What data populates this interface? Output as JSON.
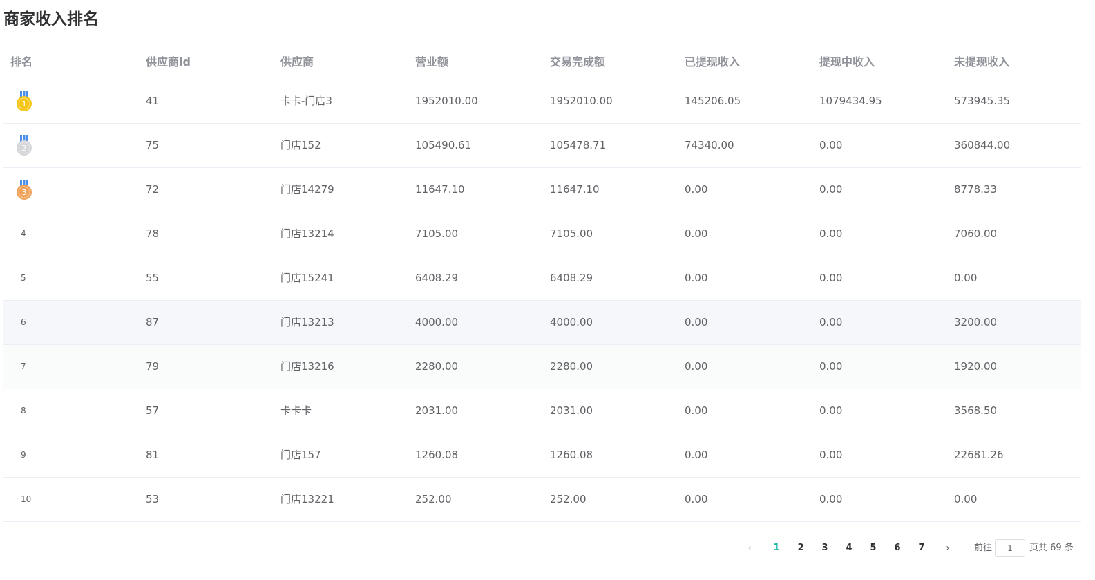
{
  "page": {
    "title": "商家收入排名"
  },
  "table": {
    "headers": [
      "排名",
      "供应商id",
      "供应商",
      "营业额",
      "交易完成额",
      "已提现收入",
      "提现中收入",
      "未提现收入"
    ],
    "rows": [
      {
        "rank": "1",
        "id": "41",
        "supplier": "卡卡-门店3",
        "revenue": "1952010.00",
        "completed": "1952010.00",
        "withdrawn": "145206.05",
        "withdrawing": "1079434.95",
        "not_withdrawn": "573945.35"
      },
      {
        "rank": "2",
        "id": "75",
        "supplier": "门店152",
        "revenue": "105490.61",
        "completed": "105478.71",
        "withdrawn": "74340.00",
        "withdrawing": "0.00",
        "not_withdrawn": "360844.00"
      },
      {
        "rank": "3",
        "id": "72",
        "supplier": "门店14279",
        "revenue": "11647.10",
        "completed": "11647.10",
        "withdrawn": "0.00",
        "withdrawing": "0.00",
        "not_withdrawn": "8778.33"
      },
      {
        "rank": "4",
        "id": "78",
        "supplier": "门店13214",
        "revenue": "7105.00",
        "completed": "7105.00",
        "withdrawn": "0.00",
        "withdrawing": "0.00",
        "not_withdrawn": "7060.00"
      },
      {
        "rank": "5",
        "id": "55",
        "supplier": "门店15241",
        "revenue": "6408.29",
        "completed": "6408.29",
        "withdrawn": "0.00",
        "withdrawing": "0.00",
        "not_withdrawn": "0.00"
      },
      {
        "rank": "6",
        "id": "87",
        "supplier": "门店13213",
        "revenue": "4000.00",
        "completed": "4000.00",
        "withdrawn": "0.00",
        "withdrawing": "0.00",
        "not_withdrawn": "3200.00"
      },
      {
        "rank": "7",
        "id": "79",
        "supplier": "门店13216",
        "revenue": "2280.00",
        "completed": "2280.00",
        "withdrawn": "0.00",
        "withdrawing": "0.00",
        "not_withdrawn": "1920.00"
      },
      {
        "rank": "8",
        "id": "57",
        "supplier": "卡卡卡",
        "revenue": "2031.00",
        "completed": "2031.00",
        "withdrawn": "0.00",
        "withdrawing": "0.00",
        "not_withdrawn": "3568.50"
      },
      {
        "rank": "9",
        "id": "81",
        "supplier": "门店157",
        "revenue": "1260.08",
        "completed": "1260.08",
        "withdrawn": "0.00",
        "withdrawing": "0.00",
        "not_withdrawn": "22681.26"
      },
      {
        "rank": "10",
        "id": "53",
        "supplier": "门店13221",
        "revenue": "252.00",
        "completed": "252.00",
        "withdrawn": "0.00",
        "withdrawing": "0.00",
        "not_withdrawn": "0.00"
      }
    ],
    "medals": {
      "gold": "#f5c518",
      "silver": "#d4d6da",
      "bronze": "#f0a25a",
      "ribbon": "#4a8ee8"
    }
  },
  "pagination": {
    "prev_icon": "chevron-left-icon",
    "next_icon": "chevron-right-icon",
    "prev_symbol": "‹",
    "next_symbol": "›",
    "pages": [
      "1",
      "2",
      "3",
      "4",
      "5",
      "6",
      "7"
    ],
    "active_page": "1",
    "goto_label": "前往",
    "goto_value": "1",
    "total_text": "页共 69 条",
    "active_color": "#13b5a3"
  }
}
